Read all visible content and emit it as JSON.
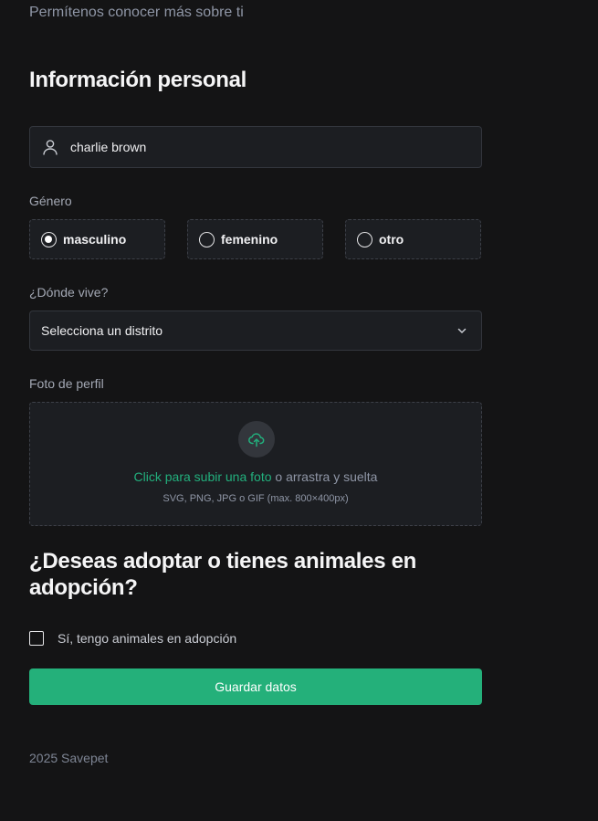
{
  "intro": "Permítenos conocer más sobre ti",
  "personal": {
    "title": "Información personal",
    "name_value": "charlie brown",
    "name_icon": "user-icon"
  },
  "gender": {
    "label": "Género",
    "options": [
      {
        "label": "masculino",
        "checked": true
      },
      {
        "label": "femenino",
        "checked": false
      },
      {
        "label": "otro",
        "checked": false
      }
    ]
  },
  "location": {
    "label": "¿Dónde vive?",
    "selected": "Selecciona un distrito",
    "icon": "chevron-down-icon"
  },
  "photo": {
    "label": "Foto de perfil",
    "upload_icon": "cloud-upload-icon",
    "link_text": "Click para subir una foto",
    "rest_text": "o arrastra y suelta",
    "hint": "SVG, PNG, JPG o GIF (max. 800×400px)"
  },
  "adoption": {
    "title": "¿Deseas adoptar o tienes animales en adopción?",
    "checkbox_label": "Sí, tengo animales en adopción",
    "checked": false
  },
  "save_label": "Guardar datos",
  "footer": "2025 Savepet",
  "colors": {
    "background": "#141415",
    "field": "#1c1e22",
    "accent": "#24b07a",
    "link": "#22b07d"
  }
}
